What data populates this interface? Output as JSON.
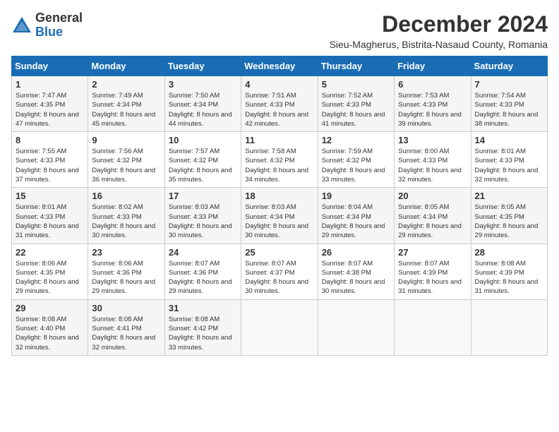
{
  "logo": {
    "text_general": "General",
    "text_blue": "Blue"
  },
  "title": "December 2024",
  "location": "Sieu-Magherus, Bistrita-Nasaud County, Romania",
  "days_of_week": [
    "Sunday",
    "Monday",
    "Tuesday",
    "Wednesday",
    "Thursday",
    "Friday",
    "Saturday"
  ],
  "weeks": [
    [
      {
        "day": "1",
        "sunrise": "7:47 AM",
        "sunset": "4:35 PM",
        "daylight": "8 hours and 47 minutes."
      },
      {
        "day": "2",
        "sunrise": "7:49 AM",
        "sunset": "4:34 PM",
        "daylight": "8 hours and 45 minutes."
      },
      {
        "day": "3",
        "sunrise": "7:50 AM",
        "sunset": "4:34 PM",
        "daylight": "8 hours and 44 minutes."
      },
      {
        "day": "4",
        "sunrise": "7:51 AM",
        "sunset": "4:33 PM",
        "daylight": "8 hours and 42 minutes."
      },
      {
        "day": "5",
        "sunrise": "7:52 AM",
        "sunset": "4:33 PM",
        "daylight": "8 hours and 41 minutes."
      },
      {
        "day": "6",
        "sunrise": "7:53 AM",
        "sunset": "4:33 PM",
        "daylight": "8 hours and 39 minutes."
      },
      {
        "day": "7",
        "sunrise": "7:54 AM",
        "sunset": "4:33 PM",
        "daylight": "8 hours and 38 minutes."
      }
    ],
    [
      {
        "day": "8",
        "sunrise": "7:55 AM",
        "sunset": "4:33 PM",
        "daylight": "8 hours and 37 minutes."
      },
      {
        "day": "9",
        "sunrise": "7:56 AM",
        "sunset": "4:32 PM",
        "daylight": "8 hours and 36 minutes."
      },
      {
        "day": "10",
        "sunrise": "7:57 AM",
        "sunset": "4:32 PM",
        "daylight": "8 hours and 35 minutes."
      },
      {
        "day": "11",
        "sunrise": "7:58 AM",
        "sunset": "4:32 PM",
        "daylight": "8 hours and 34 minutes."
      },
      {
        "day": "12",
        "sunrise": "7:59 AM",
        "sunset": "4:32 PM",
        "daylight": "8 hours and 33 minutes."
      },
      {
        "day": "13",
        "sunrise": "8:00 AM",
        "sunset": "4:33 PM",
        "daylight": "8 hours and 32 minutes."
      },
      {
        "day": "14",
        "sunrise": "8:01 AM",
        "sunset": "4:33 PM",
        "daylight": "8 hours and 32 minutes."
      }
    ],
    [
      {
        "day": "15",
        "sunrise": "8:01 AM",
        "sunset": "4:33 PM",
        "daylight": "8 hours and 31 minutes."
      },
      {
        "day": "16",
        "sunrise": "8:02 AM",
        "sunset": "4:33 PM",
        "daylight": "8 hours and 30 minutes."
      },
      {
        "day": "17",
        "sunrise": "8:03 AM",
        "sunset": "4:33 PM",
        "daylight": "8 hours and 30 minutes."
      },
      {
        "day": "18",
        "sunrise": "8:03 AM",
        "sunset": "4:34 PM",
        "daylight": "8 hours and 30 minutes."
      },
      {
        "day": "19",
        "sunrise": "8:04 AM",
        "sunset": "4:34 PM",
        "daylight": "8 hours and 29 minutes."
      },
      {
        "day": "20",
        "sunrise": "8:05 AM",
        "sunset": "4:34 PM",
        "daylight": "8 hours and 29 minutes."
      },
      {
        "day": "21",
        "sunrise": "8:05 AM",
        "sunset": "4:35 PM",
        "daylight": "8 hours and 29 minutes."
      }
    ],
    [
      {
        "day": "22",
        "sunrise": "8:06 AM",
        "sunset": "4:35 PM",
        "daylight": "8 hours and 29 minutes."
      },
      {
        "day": "23",
        "sunrise": "8:06 AM",
        "sunset": "4:36 PM",
        "daylight": "8 hours and 29 minutes."
      },
      {
        "day": "24",
        "sunrise": "8:07 AM",
        "sunset": "4:36 PM",
        "daylight": "8 hours and 29 minutes."
      },
      {
        "day": "25",
        "sunrise": "8:07 AM",
        "sunset": "4:37 PM",
        "daylight": "8 hours and 30 minutes."
      },
      {
        "day": "26",
        "sunrise": "8:07 AM",
        "sunset": "4:38 PM",
        "daylight": "8 hours and 30 minutes."
      },
      {
        "day": "27",
        "sunrise": "8:07 AM",
        "sunset": "4:39 PM",
        "daylight": "8 hours and 31 minutes."
      },
      {
        "day": "28",
        "sunrise": "8:08 AM",
        "sunset": "4:39 PM",
        "daylight": "8 hours and 31 minutes."
      }
    ],
    [
      {
        "day": "29",
        "sunrise": "8:08 AM",
        "sunset": "4:40 PM",
        "daylight": "8 hours and 32 minutes."
      },
      {
        "day": "30",
        "sunrise": "8:08 AM",
        "sunset": "4:41 PM",
        "daylight": "8 hours and 32 minutes."
      },
      {
        "day": "31",
        "sunrise": "8:08 AM",
        "sunset": "4:42 PM",
        "daylight": "8 hours and 33 minutes."
      },
      null,
      null,
      null,
      null
    ]
  ]
}
